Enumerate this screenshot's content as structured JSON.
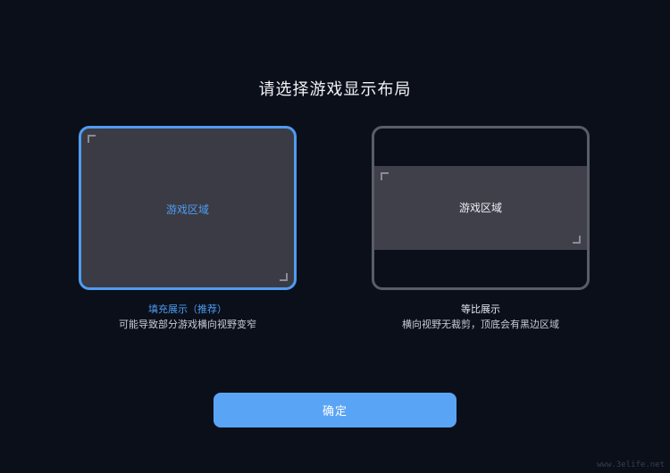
{
  "dialog": {
    "title": "请选择游戏显示布局",
    "confirm_label": "确定"
  },
  "options": [
    {
      "id": "fill",
      "area_label": "游戏区域",
      "title": "填充展示（推荐）",
      "description": "可能导致部分游戏横向视野变窄",
      "selected": true
    },
    {
      "id": "fit",
      "area_label": "游戏区域",
      "title": "等比展示",
      "description": "横向视野无裁剪，顶底会有黑边区域",
      "selected": false
    }
  ],
  "watermark": "www.3elife.net",
  "colors": {
    "background": "#0a0f1a",
    "accent": "#4f9cf0",
    "button": "#5aa4f5",
    "card_fill": "#3a3b44",
    "unselected_border": "#5a5d66"
  }
}
